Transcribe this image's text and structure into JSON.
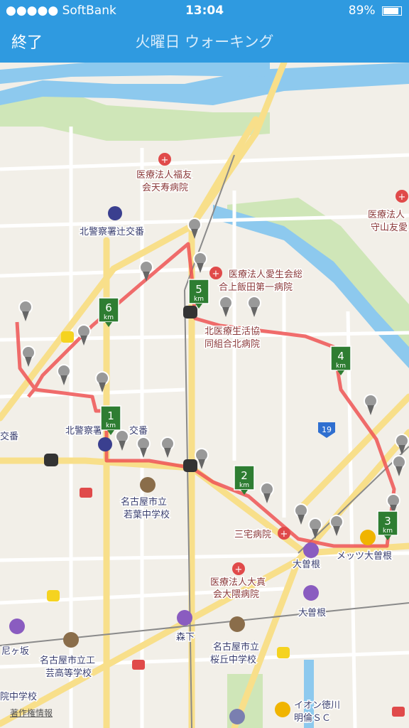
{
  "status": {
    "carrier": "●●●●● SoftBank",
    "time": "13:04",
    "battery": "89%"
  },
  "nav": {
    "done_label": "終了",
    "title": "火曜日 ウォーキング"
  },
  "map": {
    "labels": {
      "hospital_fukuyu": "医療法人福友",
      "hospital_fukuyu2": "会天寿病院",
      "hospital_right": "医療法人",
      "hospital_right2": "守山友愛",
      "police_tsuji": "北警察署辻交番",
      "hospital_aisei": "医療法人愛生会総",
      "hospital_aisei2": "合上飯田第一病院",
      "hospital_kita": "北医療生活協",
      "hospital_kita2": "同組合北病院",
      "police_2": "北警察署",
      "police_2b": "交番",
      "koban_left": "交番",
      "school_wakaba": "名古屋市立",
      "school_wakaba2": "若葉中学校",
      "miyake": "三宅病院",
      "ozone": "大曽根",
      "ozone2": "大曽根",
      "mets": "メッツ大曽根",
      "hospital_ookuma": "医療法人大真",
      "hospital_ookuma2": "会大隈病院",
      "morishita": "森下",
      "amagasaka": "尼ヶ坂",
      "school_koko": "名古屋市立工",
      "school_koko2": "芸高等学校",
      "school_sakuragaoka": "名古屋市立",
      "school_sakuragaoka2": "桜丘中学校",
      "school_left": "院中学校",
      "aeon": "イオン徳川",
      "aeon2": "明倫ＳＣ",
      "route19": "19"
    },
    "km_markers": [
      "1",
      "2",
      "3",
      "4",
      "5",
      "6"
    ],
    "km_unit": "km",
    "copyright": "著作権情報"
  }
}
